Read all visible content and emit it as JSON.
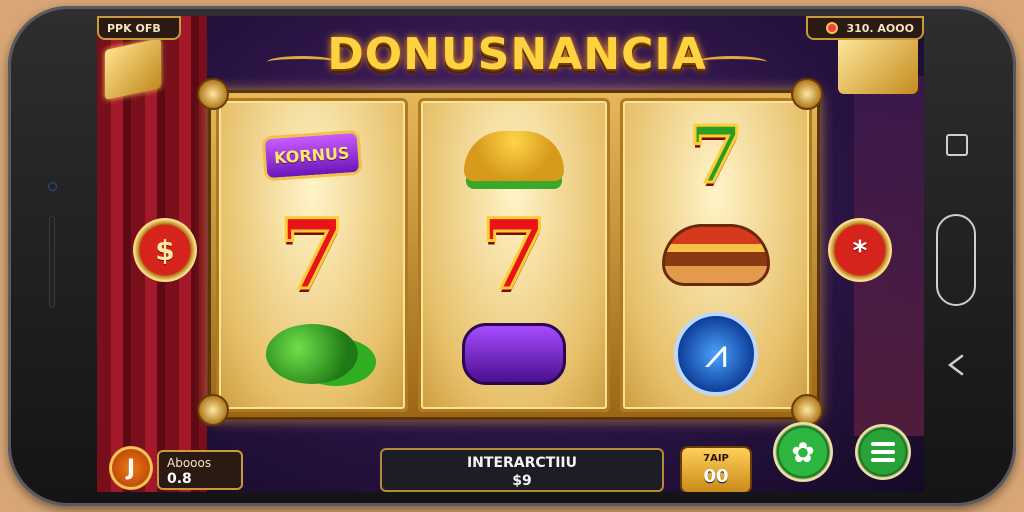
{
  "hud": {
    "left_label": "PPK OFB",
    "right_label": "310. AOOO"
  },
  "title": "DONUSNANCIA",
  "side_buttons": {
    "left_symbol": "$",
    "right_symbol": "*"
  },
  "reels": [
    {
      "symbols": [
        {
          "type": "badge",
          "text": "KORNUS"
        },
        {
          "type": "seven",
          "text": "7",
          "color": "#e8141a"
        },
        {
          "type": "clover"
        }
      ]
    },
    {
      "symbols": [
        {
          "type": "leaves"
        },
        {
          "type": "seven",
          "text": "7",
          "color": "#e8141a"
        },
        {
          "type": "purple-box"
        }
      ]
    },
    {
      "symbols": [
        {
          "type": "seven",
          "text": "7",
          "color": "#2a9d23"
        },
        {
          "type": "burger"
        },
        {
          "type": "blue-gem",
          "text": "⩘"
        }
      ]
    }
  ],
  "bottom": {
    "coin_symbol": "J",
    "balance_label": "Abooos",
    "balance_value": "0.8",
    "info_title": "INTERARCTIIU",
    "info_value": "$9",
    "bet_label": "7AIP",
    "bet_value": "00",
    "spin_symbol": "✿"
  },
  "colors": {
    "gold": "#e7b85a",
    "title": "#ffd23f",
    "curtain": "#a3192a",
    "spin_green": "#2fb640"
  }
}
